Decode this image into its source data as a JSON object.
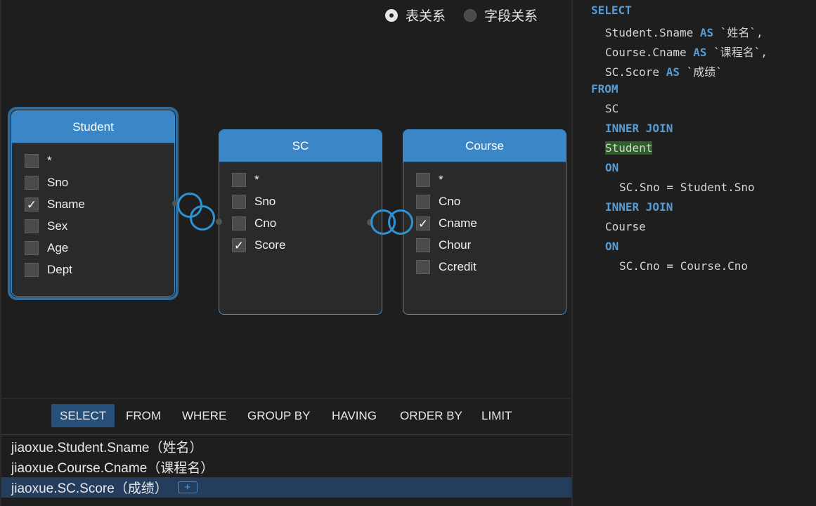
{
  "mode": {
    "options": [
      {
        "label": "表关系",
        "selected": true
      },
      {
        "label": "字段关系",
        "selected": false
      }
    ]
  },
  "tables": {
    "student": {
      "name": "Student",
      "selected": true,
      "fields": [
        {
          "name": "*",
          "checked": false
        },
        {
          "name": "Sno",
          "checked": false
        },
        {
          "name": "Sname",
          "checked": true
        },
        {
          "name": "Sex",
          "checked": false
        },
        {
          "name": "Age",
          "checked": false
        },
        {
          "name": "Dept",
          "checked": false
        }
      ]
    },
    "sc": {
      "name": "SC",
      "selected": false,
      "fields": [
        {
          "name": "*",
          "checked": false
        },
        {
          "name": "Sno",
          "checked": false
        },
        {
          "name": "Cno",
          "checked": false
        },
        {
          "name": "Score",
          "checked": true
        }
      ]
    },
    "course": {
      "name": "Course",
      "selected": false,
      "fields": [
        {
          "name": "*",
          "checked": false
        },
        {
          "name": "Cno",
          "checked": false
        },
        {
          "name": "Cname",
          "checked": true
        },
        {
          "name": "Chour",
          "checked": false
        },
        {
          "name": "Ccredit",
          "checked": false
        }
      ]
    }
  },
  "clauses": {
    "tabs": [
      "SELECT",
      "FROM",
      "WHERE",
      "GROUP BY",
      "HAVING",
      "ORDER BY",
      "LIMIT"
    ],
    "active": "SELECT"
  },
  "selected_columns": [
    {
      "text": "jiaoxue.Student.Sname（姓名）",
      "active": false
    },
    {
      "text": "jiaoxue.Course.Cname（课程名）",
      "active": false
    },
    {
      "text": "jiaoxue.SC.Score（成绩）",
      "active": true
    }
  ],
  "add_button": "+",
  "sql": {
    "select_kw": "SELECT",
    "col1": "Student.Sname",
    "col1_as": "AS",
    "col1_alias": "`姓名`,",
    "col2": "Course.Cname",
    "col2_as": "AS",
    "col2_alias": "`课程名`,",
    "col3": "SC.Score",
    "col3_as": "AS",
    "col3_alias": "`成绩`",
    "from_kw": "FROM",
    "from_table": "SC",
    "join1_kw": "INNER JOIN",
    "join1_table": "Student",
    "on1_kw": "ON",
    "on1_cond": "SC.Sno = Student.Sno",
    "join2_kw": "INNER JOIN",
    "join2_table": "Course",
    "on2_kw": "ON",
    "on2_cond": "SC.Cno = Course.Cno"
  },
  "colors": {
    "accent": "#3a86c6",
    "keyword": "#569cd6",
    "highlight": "#2e5e2a",
    "active_row": "#243d5c"
  }
}
